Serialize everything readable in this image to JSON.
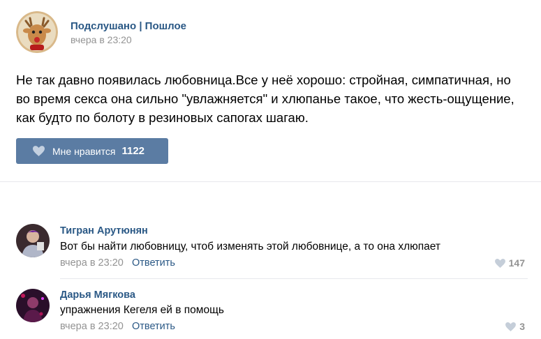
{
  "post": {
    "author": "Подслушано | Пошлое",
    "date": "вчера в 23:20",
    "text": "Не так давно появилась любовница.Все у неё хорошо: стройная, симпатичная, но во время секса она сильно \"увлажняется\" и хлюпанье такое, что жесть-ощущение, как будто по болоту в резиновых сапогах шагаю.",
    "like_label": "Мне нравится",
    "like_count": "1122"
  },
  "comments": [
    {
      "name": "Тигран Арутюнян",
      "text": "Вот бы найти любовницу, чтоб изменять этой любовнице, а то она хлюпает",
      "date": "вчера в 23:20",
      "reply": "Ответить",
      "likes": "147"
    },
    {
      "name": "Дарья Мягкова",
      "text": "упражнения Кегеля ей в помощь",
      "date": "вчера в 23:20",
      "reply": "Ответить",
      "likes": "3"
    }
  ],
  "colors": {
    "link": "#2a5885",
    "muted": "#939393",
    "like_button": "#5b7ca3"
  },
  "icons": [
    "heart-icon"
  ]
}
